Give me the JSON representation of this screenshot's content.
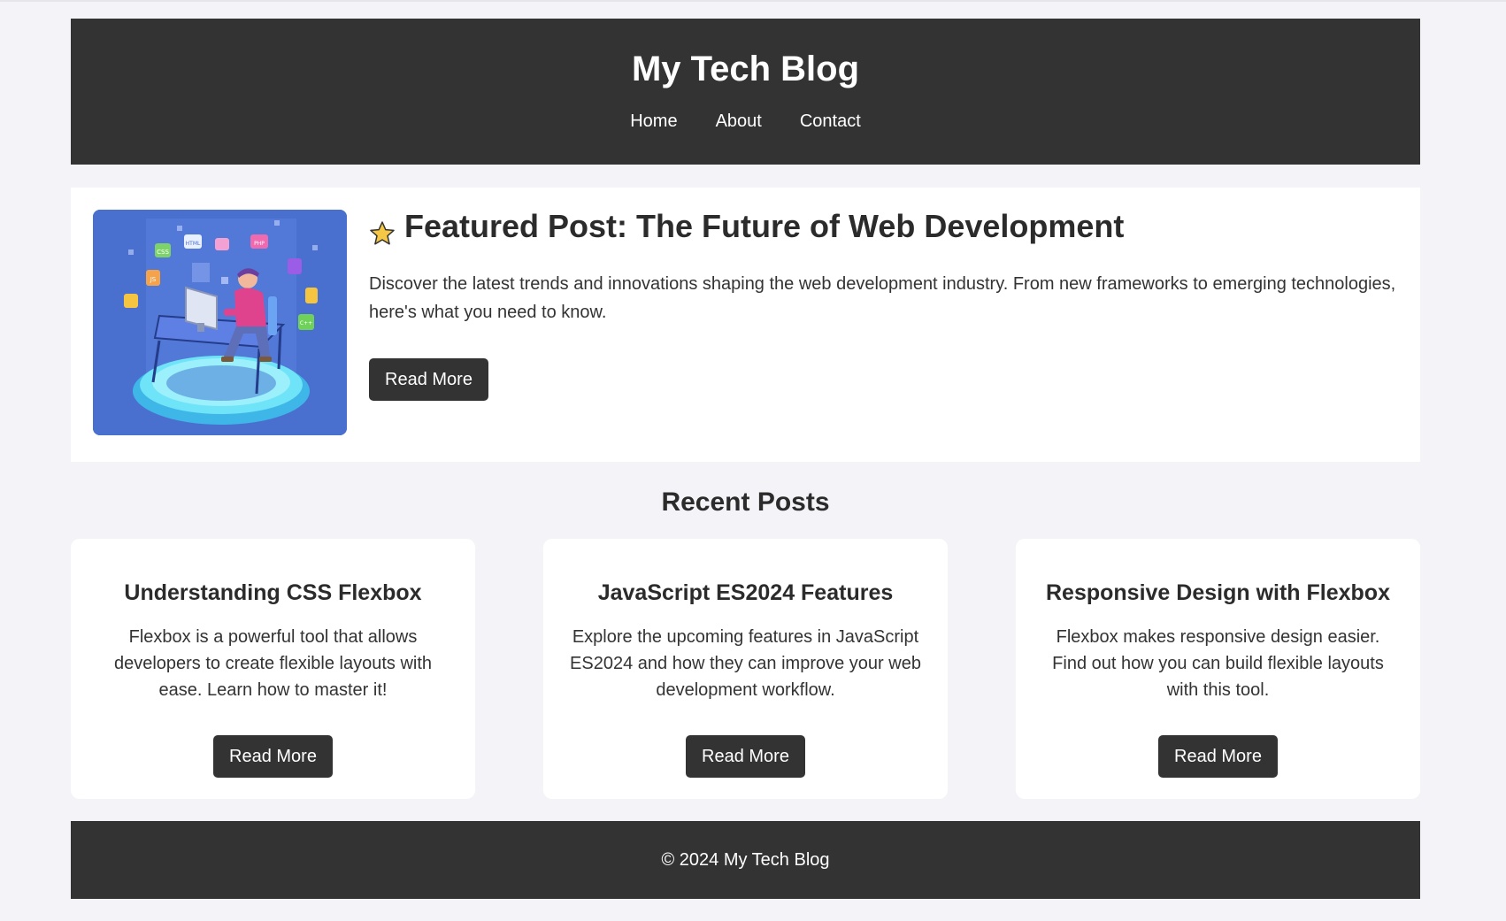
{
  "site": {
    "title": "My Tech Blog",
    "nav": [
      {
        "label": "Home"
      },
      {
        "label": "About"
      },
      {
        "label": "Contact"
      }
    ]
  },
  "featured": {
    "icon": "star-icon",
    "title": "Featured Post: The Future of Web Development",
    "text": "Discover the latest trends and innovations shaping the web development industry. From new frameworks to emerging technologies, here's what you need to know.",
    "button_label": "Read More",
    "image_badges": [
      "CSS",
      "HTML",
      "PHP",
      "JS",
      "C++"
    ]
  },
  "recent": {
    "heading": "Recent Posts",
    "posts": [
      {
        "title": "Understanding CSS Flexbox",
        "text": "Flexbox is a powerful tool that allows developers to create flexible layouts with ease. Learn how to master it!",
        "button_label": "Read More"
      },
      {
        "title": "JavaScript ES2024 Features",
        "text": "Explore the upcoming features in JavaScript ES2024 and how they can improve your web development workflow.",
        "button_label": "Read More"
      },
      {
        "title": "Responsive Design with Flexbox",
        "text": "Flexbox makes responsive design easier. Find out how you can build flexible layouts with this tool.",
        "button_label": "Read More"
      }
    ]
  },
  "footer": {
    "text": "© 2024 My Tech Blog"
  },
  "colors": {
    "header_bg": "#333333",
    "page_bg": "#f4f4f8",
    "image_bg": "#4a70cf",
    "star": "#f6c744"
  }
}
